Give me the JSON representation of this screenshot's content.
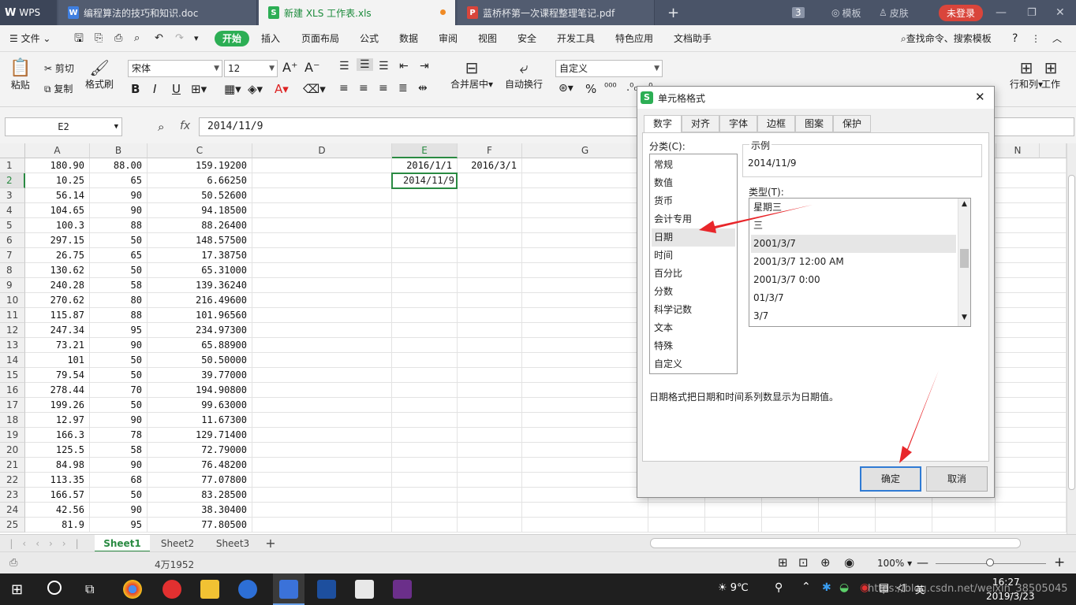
{
  "app": {
    "name": "WPS"
  },
  "tabs": [
    {
      "label": "编程算法的技巧和知识.doc",
      "icon": "W"
    },
    {
      "label": "新建 XLS 工作表.xls",
      "icon": "S"
    },
    {
      "label": "蓝桥杯第一次课程整理笔记.pdf",
      "icon": "P"
    }
  ],
  "topright": {
    "count": "3",
    "templates": "模板",
    "skin": "皮肤",
    "login": "未登录"
  },
  "menu": {
    "file": "文件",
    "items": [
      "开始",
      "插入",
      "页面布局",
      "公式",
      "数据",
      "审阅",
      "视图",
      "安全",
      "开发工具",
      "特色应用",
      "文档助手"
    ],
    "search": "查找命令、搜索模板"
  },
  "ribbon": {
    "paste": "粘贴",
    "cut": "剪切",
    "copy": "复制",
    "format_painter": "格式刷",
    "font": "宋体",
    "size": "12",
    "merge": "合并居中",
    "wrap": "自动换行",
    "numfmt": "自定义",
    "rowcol": "行和列",
    "sheet": "工作"
  },
  "formula": {
    "namebox": "E2",
    "fx": "fx",
    "value": "2014/11/9"
  },
  "columns": [
    "A",
    "B",
    "C",
    "D",
    "E",
    "F",
    "G",
    "N"
  ],
  "rows": [
    {
      "n": "1",
      "a": "180.90",
      "b": "88.00",
      "c": "159.19200"
    },
    {
      "n": "2",
      "a": "10.25",
      "b": "65",
      "c": "6.66250"
    },
    {
      "n": "3",
      "a": "56.14",
      "b": "90",
      "c": "50.52600"
    },
    {
      "n": "4",
      "a": "104.65",
      "b": "90",
      "c": "94.18500"
    },
    {
      "n": "5",
      "a": "100.3",
      "b": "88",
      "c": "88.26400"
    },
    {
      "n": "6",
      "a": "297.15",
      "b": "50",
      "c": "148.57500"
    },
    {
      "n": "7",
      "a": "26.75",
      "b": "65",
      "c": "17.38750"
    },
    {
      "n": "8",
      "a": "130.62",
      "b": "50",
      "c": "65.31000"
    },
    {
      "n": "9",
      "a": "240.28",
      "b": "58",
      "c": "139.36240"
    },
    {
      "n": "10",
      "a": "270.62",
      "b": "80",
      "c": "216.49600"
    },
    {
      "n": "11",
      "a": "115.87",
      "b": "88",
      "c": "101.96560"
    },
    {
      "n": "12",
      "a": "247.34",
      "b": "95",
      "c": "234.97300"
    },
    {
      "n": "13",
      "a": "73.21",
      "b": "90",
      "c": "65.88900"
    },
    {
      "n": "14",
      "a": "101",
      "b": "50",
      "c": "50.50000"
    },
    {
      "n": "15",
      "a": "79.54",
      "b": "50",
      "c": "39.77000"
    },
    {
      "n": "16",
      "a": "278.44",
      "b": "70",
      "c": "194.90800"
    },
    {
      "n": "17",
      "a": "199.26",
      "b": "50",
      "c": "99.63000"
    },
    {
      "n": "18",
      "a": "12.97",
      "b": "90",
      "c": "11.67300"
    },
    {
      "n": "19",
      "a": "166.3",
      "b": "78",
      "c": "129.71400"
    },
    {
      "n": "20",
      "a": "125.5",
      "b": "58",
      "c": "72.79000"
    },
    {
      "n": "21",
      "a": "84.98",
      "b": "90",
      "c": "76.48200"
    },
    {
      "n": "22",
      "a": "113.35",
      "b": "68",
      "c": "77.07800"
    },
    {
      "n": "23",
      "a": "166.57",
      "b": "50",
      "c": "83.28500"
    },
    {
      "n": "24",
      "a": "42.56",
      "b": "90",
      "c": "38.30400"
    },
    {
      "n": "25",
      "a": "81.9",
      "b": "95",
      "c": "77.80500"
    }
  ],
  "cells": {
    "e1": "2016/1/1",
    "f1": "2016/3/1",
    "e2": "2014/11/9"
  },
  "sheets": [
    "Sheet1",
    "Sheet2",
    "Sheet3"
  ],
  "status": {
    "sum": "4万1952",
    "zoom": "100%"
  },
  "taskbar": {
    "temp": "9℃",
    "lang": "英",
    "time": "16:27",
    "date": "2019/3/23",
    "watermark": "https://blog.csdn.net/weixin_38505045"
  },
  "dialog": {
    "title": "单元格格式",
    "tabs": [
      "数字",
      "对齐",
      "字体",
      "边框",
      "图案",
      "保护"
    ],
    "category_label": "分类(C):",
    "categories": [
      "常规",
      "数值",
      "货币",
      "会计专用",
      "日期",
      "时间",
      "百分比",
      "分数",
      "科学记数",
      "文本",
      "特殊",
      "自定义"
    ],
    "sample_label": "示例",
    "sample": "2014/11/9",
    "type_label": "类型(T):",
    "types": [
      "星期三",
      "三",
      "2001/3/7",
      "2001/3/7 12:00 AM",
      "2001/3/7 0:00",
      "01/3/7",
      "3/7"
    ],
    "description": "日期格式把日期和时间系列数显示为日期值。",
    "ok": "确定",
    "cancel": "取消"
  }
}
